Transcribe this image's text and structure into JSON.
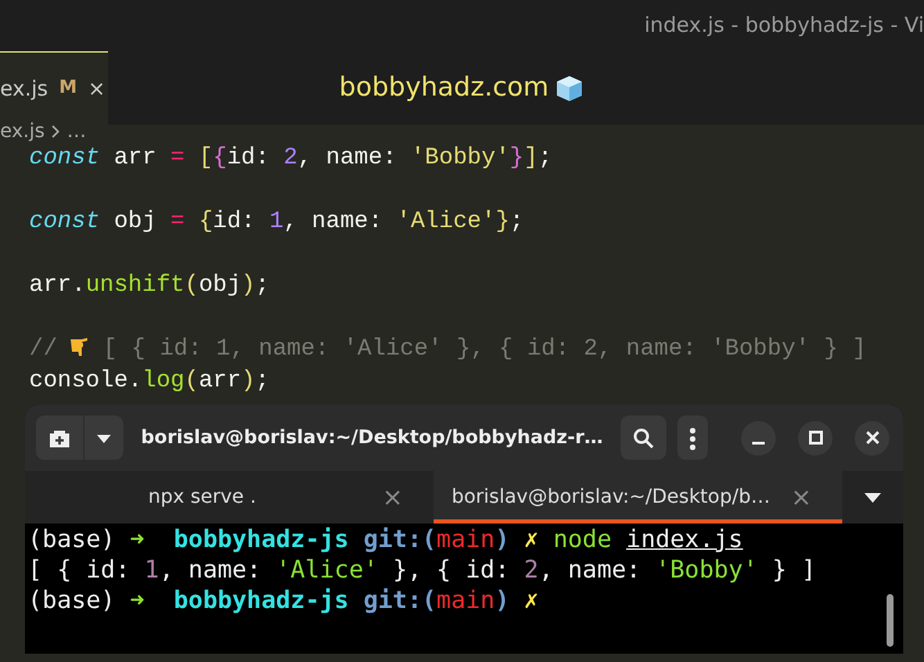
{
  "window": {
    "title": "index.js - bobbyhadz-js - Vi"
  },
  "editor_tab": {
    "label": "ex.js",
    "badge": "M",
    "close": "×",
    "selected": true
  },
  "site_banner": {
    "text": "bobbyhadz.com"
  },
  "breadcrumb": {
    "file": "ex.js",
    "more": "…"
  },
  "code_lines": [
    {
      "blank_after": true,
      "tokens": [
        {
          "text": "const",
          "kind": "keyword"
        },
        {
          "text": " arr ",
          "kind": "plain"
        },
        {
          "text": "= ",
          "kind": "operator"
        },
        {
          "text": "[",
          "kind": "bracket"
        },
        {
          "text": "{",
          "kind": "bracket2"
        },
        {
          "text": "id: ",
          "kind": "plain"
        },
        {
          "text": "2",
          "kind": "number"
        },
        {
          "text": ", name: ",
          "kind": "plain"
        },
        {
          "text": "'Bobby'",
          "kind": "string"
        },
        {
          "text": "}",
          "kind": "bracket2"
        },
        {
          "text": "]",
          "kind": "bracket"
        },
        {
          "text": ";",
          "kind": "plain"
        }
      ]
    },
    {
      "blank_after": true,
      "tokens": [
        {
          "text": "const",
          "kind": "keyword"
        },
        {
          "text": " obj ",
          "kind": "plain"
        },
        {
          "text": "= ",
          "kind": "operator"
        },
        {
          "text": "{",
          "kind": "bracket"
        },
        {
          "text": "id: ",
          "kind": "plain"
        },
        {
          "text": "1",
          "kind": "number"
        },
        {
          "text": ", name: ",
          "kind": "plain"
        },
        {
          "text": "'Alice'",
          "kind": "string"
        },
        {
          "text": "}",
          "kind": "bracket"
        },
        {
          "text": ";",
          "kind": "plain"
        }
      ]
    },
    {
      "blank_after": true,
      "tokens": [
        {
          "text": "arr.",
          "kind": "plain"
        },
        {
          "text": "unshift",
          "kind": "function"
        },
        {
          "text": "(",
          "kind": "bracket"
        },
        {
          "text": "obj",
          "kind": "plain"
        },
        {
          "text": ")",
          "kind": "bracket"
        },
        {
          "text": ";",
          "kind": "plain"
        }
      ]
    },
    {
      "blank_after": false,
      "tokens": [
        {
          "text": "//",
          "kind": "comment"
        },
        {
          "kind": "pointing-hand"
        },
        {
          "text": "[ { id: 1, name: 'Alice' }, { id: 2, name: 'Bobby' } ]",
          "kind": "comment"
        }
      ]
    },
    {
      "blank_after": false,
      "tokens": [
        {
          "text": "console.",
          "kind": "plain"
        },
        {
          "text": "log",
          "kind": "function"
        },
        {
          "text": "(",
          "kind": "bracket"
        },
        {
          "text": "arr",
          "kind": "plain"
        },
        {
          "text": ")",
          "kind": "bracket"
        },
        {
          "text": ";",
          "kind": "plain"
        }
      ]
    }
  ],
  "terminal": {
    "title": "borislav@borislav:~/Desktop/bobbyhadz-r…",
    "tabs": [
      {
        "label": "npx serve .",
        "close": "×",
        "selected": false
      },
      {
        "label": "borislav@borislav:~/Desktop/b…",
        "close": "×",
        "selected": true
      }
    ],
    "lines": [
      [
        {
          "text": "(base) ",
          "kind": "plain"
        },
        {
          "text": "➜  ",
          "kind": "arrow"
        },
        {
          "text": "bobbyhadz-js",
          "kind": "dir"
        },
        {
          "text": " git:(",
          "kind": "git"
        },
        {
          "text": "main",
          "kind": "branch"
        },
        {
          "text": ") ",
          "kind": "git"
        },
        {
          "text": "✗",
          "kind": "dirty"
        },
        {
          "text": " node ",
          "kind": "command"
        },
        {
          "text": "index.js",
          "kind": "file"
        }
      ],
      [
        {
          "text": "[ { id: ",
          "kind": "plain"
        },
        {
          "text": "1",
          "kind": "number"
        },
        {
          "text": ", name: ",
          "kind": "plain"
        },
        {
          "text": "'Alice'",
          "kind": "string"
        },
        {
          "text": " }, { id: ",
          "kind": "plain"
        },
        {
          "text": "2",
          "kind": "number"
        },
        {
          "text": ", name: ",
          "kind": "plain"
        },
        {
          "text": "'Bobby'",
          "kind": "string"
        },
        {
          "text": " } ]",
          "kind": "plain"
        }
      ],
      [
        {
          "text": "(base) ",
          "kind": "plain"
        },
        {
          "text": "➜  ",
          "kind": "arrow"
        },
        {
          "text": "bobbyhadz-js",
          "kind": "dir"
        },
        {
          "text": " git:(",
          "kind": "git"
        },
        {
          "text": "main",
          "kind": "branch"
        },
        {
          "text": ") ",
          "kind": "git"
        },
        {
          "text": "✗",
          "kind": "dirty"
        }
      ]
    ]
  }
}
